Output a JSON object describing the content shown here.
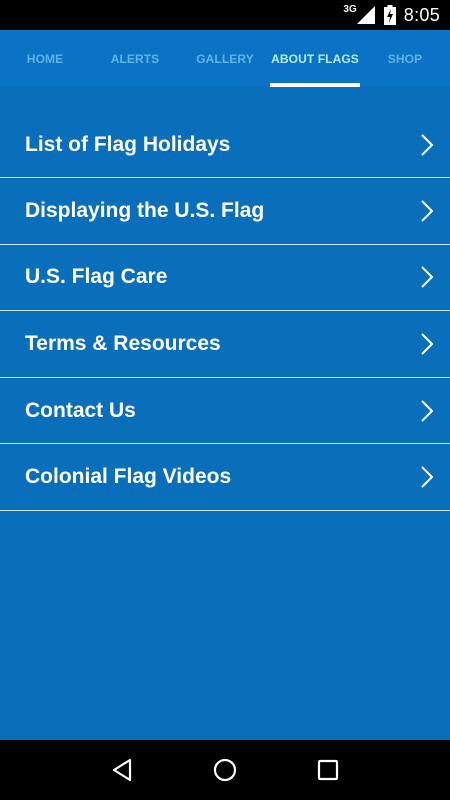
{
  "status_bar": {
    "network": "3G",
    "time": "8:05"
  },
  "tabs": [
    {
      "label": "HOME",
      "active": false
    },
    {
      "label": "ALERTS",
      "active": false
    },
    {
      "label": "GALLERY",
      "active": false
    },
    {
      "label": "ABOUT FLAGS",
      "active": true
    },
    {
      "label": "SHOP",
      "active": false
    }
  ],
  "menu": {
    "items": [
      {
        "label": "List of Flag Holidays",
        "icon": "chevron-right-icon"
      },
      {
        "label": "Displaying the U.S. Flag",
        "icon": "chevron-right-icon"
      },
      {
        "label": "U.S. Flag Care",
        "icon": "chevron-right-icon"
      },
      {
        "label": "Terms & Resources",
        "icon": "chevron-right-icon"
      },
      {
        "label": "Contact Us",
        "icon": "chevron-right-icon"
      },
      {
        "label": "Colonial Flag Videos",
        "icon": "chevron-right-icon"
      }
    ]
  },
  "nav_bar": {
    "icons": [
      "back-icon",
      "home-icon",
      "recents-icon"
    ]
  },
  "colors": {
    "background": "#0a6fbb",
    "tab_bar": "#0a73c4",
    "active_tab_text": "#b6ecff",
    "inactive_tab_text": "#5fb4e6",
    "divider": "#cfe4f4"
  }
}
